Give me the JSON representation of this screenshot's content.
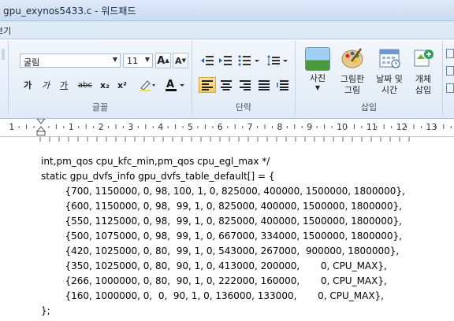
{
  "window": {
    "title": "gpu_exynos5433.c - 워드패드"
  },
  "ribbon": {
    "tab_partial": "보기",
    "font": {
      "name": "굴림",
      "size": "11"
    },
    "font_buttons": [
      "가",
      "가",
      "가",
      "abc",
      "x₂",
      "x²"
    ],
    "grow_font": "A",
    "shrink_font": "A",
    "font_group_label": "글꼴",
    "paragraph_group_label": "단락",
    "insert": {
      "picture": "사진",
      "paint": "그림판\n그림",
      "datetime": "날짜 및\n시간",
      "object": "개체\n삽입"
    },
    "insert_group_label": "삽입"
  },
  "ruler": {
    "ticks": [
      "1",
      "1",
      "2",
      "3",
      "4",
      "5",
      "6",
      "7",
      "8",
      "9",
      "10",
      "11",
      "12",
      "13"
    ]
  },
  "document": {
    "lines": [
      "int,pm_qos cpu_kfc_min,pm_qos cpu_egl_max */",
      "static gpu_dvfs_info gpu_dvfs_table_default[] = {",
      "        {700, 1150000, 0, 98, 100, 1, 0, 825000, 400000, 1500000, 1800000},",
      "        {600, 1150000, 0, 98,  99, 1, 0, 825000, 400000, 1500000, 1800000},",
      "        {550, 1125000, 0, 98,  99, 1, 0, 825000, 400000, 1500000, 1800000},",
      "        {500, 1075000, 0, 98,  99, 1, 0, 667000, 334000, 1500000, 1800000},",
      "        {420, 1025000, 0, 80,  99, 1, 0, 543000, 267000,  900000, 1800000},",
      "        {350, 1025000, 0, 80,  90, 1, 0, 413000, 200000,       0, CPU_MAX},",
      "        {266, 1000000, 0, 80,  90, 1, 0, 222000, 160000,       0, CPU_MAX},",
      "        {160, 1000000, 0,  0,  90, 1, 0, 136000, 133000,       0, CPU_MAX},",
      "};"
    ]
  }
}
